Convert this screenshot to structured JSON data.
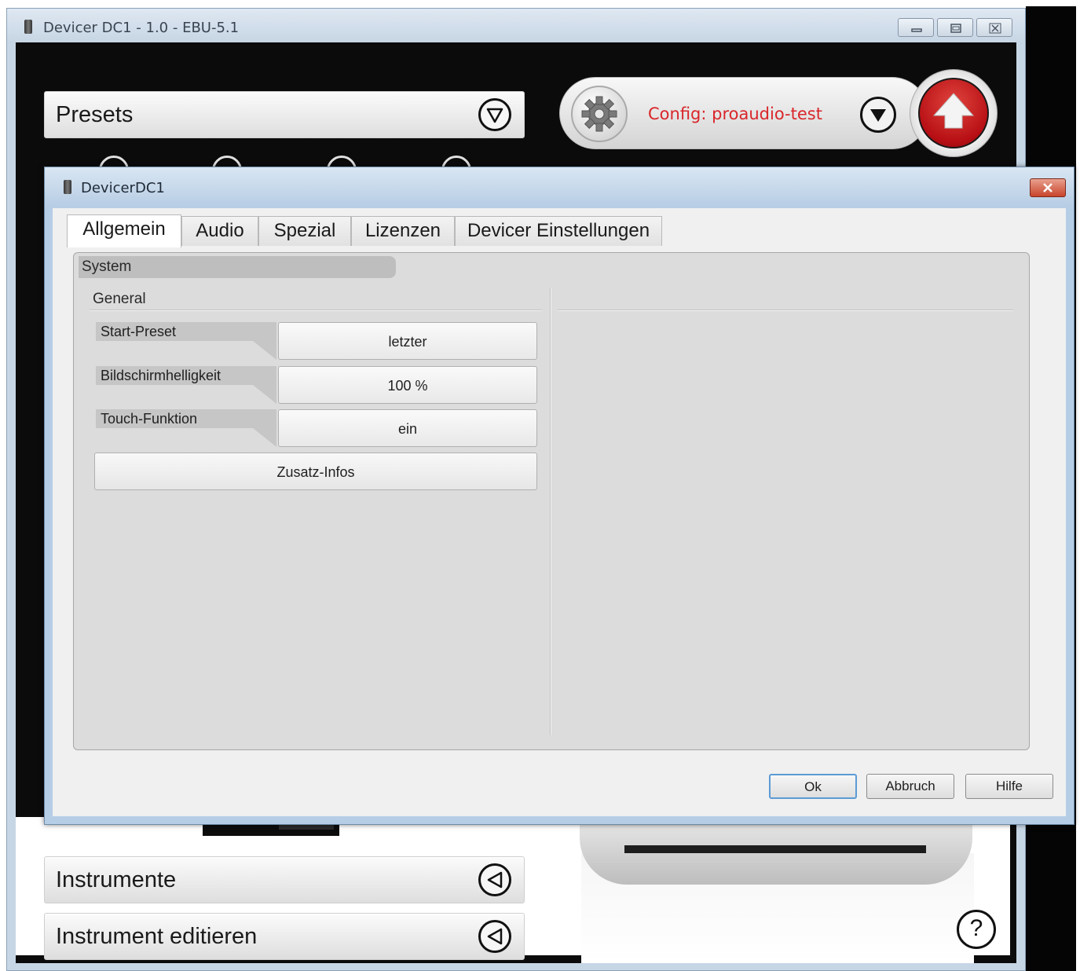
{
  "main_window": {
    "title": "Devicer DC1 - 1.0 - EBU-5.1",
    "controls": [
      "minimize",
      "maximize",
      "close"
    ]
  },
  "presets_bar": {
    "label": "Presets",
    "icon": "chevron-down-circle-icon"
  },
  "config_bar": {
    "text": "Config: proaudio-test",
    "gear_icon": "gear-icon",
    "dropdown_icon": "dropdown-circle-icon",
    "upload_icon": "arrow-up-icon"
  },
  "bottom_bars": [
    {
      "label": "Instrumente",
      "icon": "chevron-left-circle-icon"
    },
    {
      "label": "Instrument editieren",
      "icon": "chevron-left-circle-icon"
    }
  ],
  "help": {
    "glyph": "?"
  },
  "dialog": {
    "title": "DevicerDC1",
    "tabs": [
      {
        "label": "Allgemein",
        "active": true
      },
      {
        "label": "Audio",
        "active": false
      },
      {
        "label": "Spezial",
        "active": false
      },
      {
        "label": "Lizenzen",
        "active": false
      },
      {
        "label": "Devicer Einstellungen",
        "active": false
      }
    ],
    "section": "System",
    "group": "General",
    "settings": [
      {
        "label": "Start-Preset",
        "value": "letzter"
      },
      {
        "label": "Bildschirmhelligkeit",
        "value": "100 %"
      },
      {
        "label": "Touch-Funktion",
        "value": "ein"
      }
    ],
    "extra_button": "Zusatz-Infos",
    "buttons": {
      "ok": "Ok",
      "cancel": "Abbruch",
      "help": "Hilfe"
    }
  },
  "colors": {
    "accent_red": "#d9262a",
    "dialog_frame": "#b6cde6",
    "panel_bg": "#dcdcdc"
  }
}
